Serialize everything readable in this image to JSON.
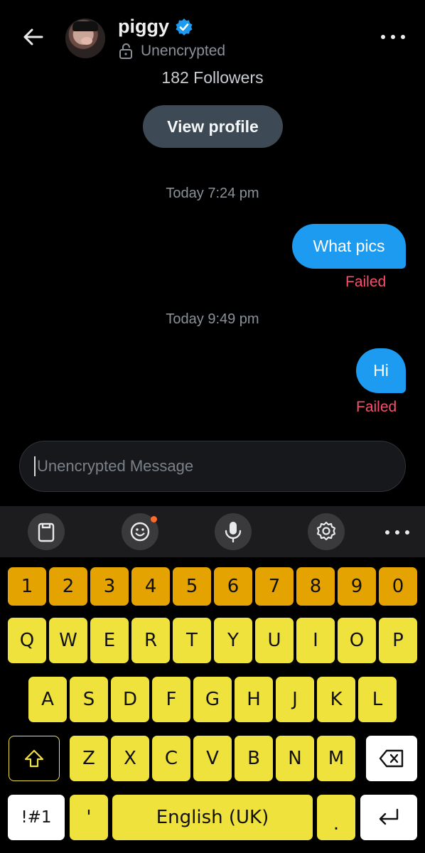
{
  "header": {
    "name": "piggy",
    "encryption_status": "Unencrypted"
  },
  "profile": {
    "followers": "182 Followers",
    "view_profile_label": "View profile"
  },
  "messages": [
    {
      "timestamp": "Today 7:24 pm",
      "text": "What pics",
      "status": "Failed"
    },
    {
      "timestamp": "Today 9:49 pm",
      "text": "Hi",
      "status": "Failed"
    }
  ],
  "composer": {
    "placeholder": "Unencrypted Message",
    "value": ""
  },
  "keyboard": {
    "toolbar_icons": [
      "clipboard-icon",
      "emoji-icon",
      "microphone-icon",
      "settings-icon",
      "more-icon"
    ],
    "number_row": [
      "1",
      "2",
      "3",
      "4",
      "5",
      "6",
      "7",
      "8",
      "9",
      "0"
    ],
    "row1": [
      "Q",
      "W",
      "E",
      "R",
      "T",
      "Y",
      "U",
      "I",
      "O",
      "P"
    ],
    "row2": [
      "A",
      "S",
      "D",
      "F",
      "G",
      "H",
      "J",
      "K",
      "L"
    ],
    "row3": [
      "Z",
      "X",
      "C",
      "V",
      "B",
      "N",
      "M"
    ],
    "symbols_label": "!#1",
    "apostrophe_label": "'",
    "space_label": "English (UK)",
    "period_label": "."
  },
  "colors": {
    "sent_bubble": "#1d9bf0",
    "failed_text": "#f4516c",
    "number_keys": "#e4a300",
    "letter_keys": "#f0e23c",
    "verified_badge": "#1d9bf0"
  }
}
